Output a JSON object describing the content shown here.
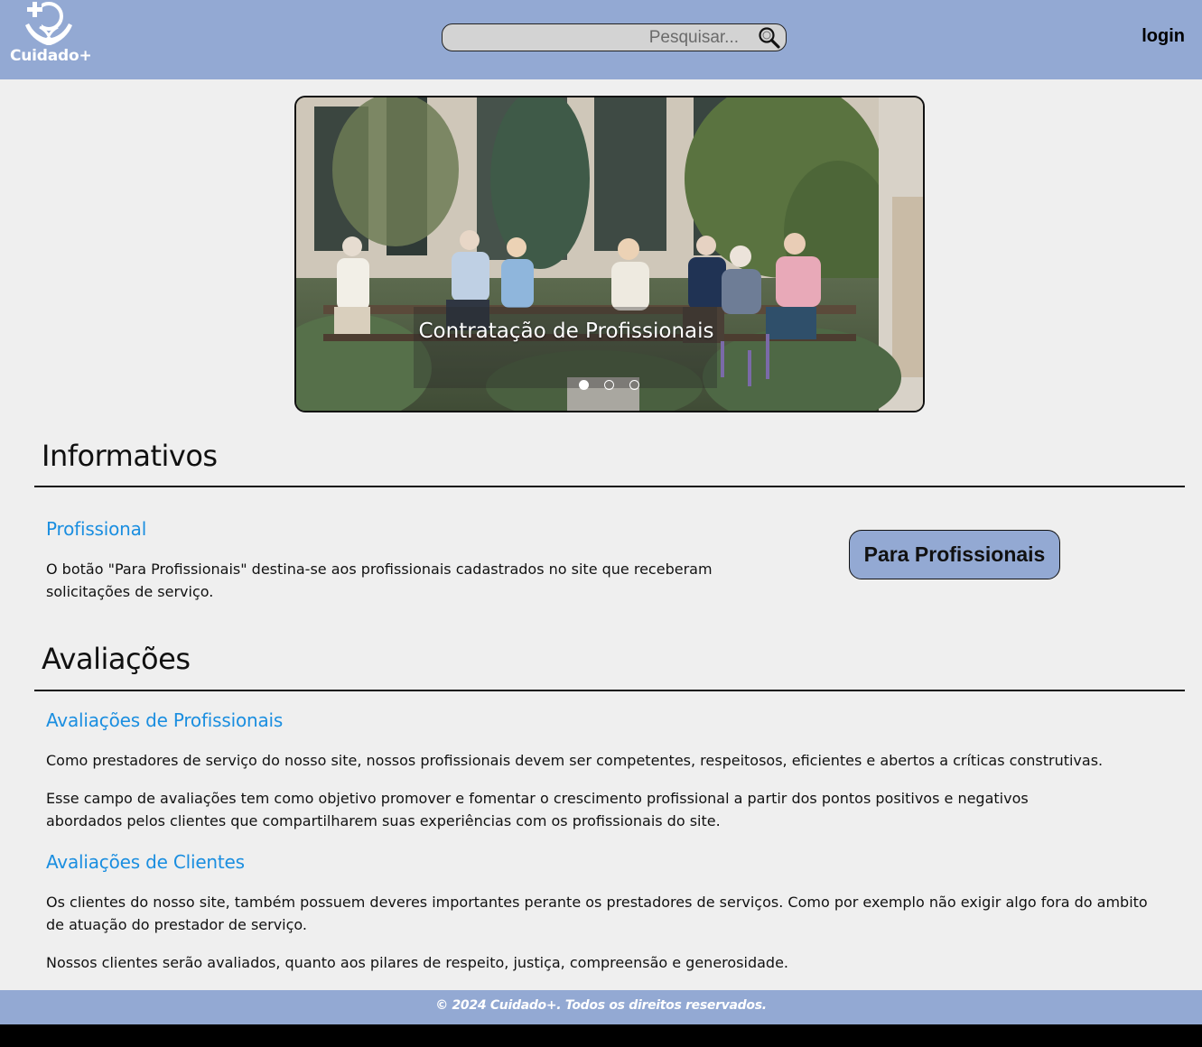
{
  "header": {
    "brand": "Cuidado+",
    "search_placeholder": "Pesquisar...",
    "login_label": "login"
  },
  "carousel": {
    "caption": "Contratação de Profissionais",
    "slides_count": 3,
    "active_slide": 1
  },
  "informativos": {
    "title": "Informativos",
    "subtitle": "Profissional",
    "text": "O botão \"Para Profissionais\" destina-se aos profissionais cadastrados no site que receberam solicitações de serviço.",
    "button_label": "Para Profissionais"
  },
  "avaliacoes": {
    "title": "Avaliações",
    "profissionais_title": "Avaliações de Profissionais",
    "profissionais_p1": "Como prestadores de serviço do nosso site, nossos profissionais devem ser competentes, respeitosos, eficientes e abertos a críticas construtivas.",
    "profissionais_p2": "Esse campo de avaliações tem como objetivo promover e fomentar o crescimento profissional a partir dos pontos positivos e negativos abordados pelos clientes que compartilharem suas experiências com os profissionais do site.",
    "clientes_title": "Avaliações de Clientes",
    "clientes_p1": "Os clientes do nosso site, também possuem deveres importantes perante os prestadores de serviços. Como por exemplo não exigir algo fora do ambito de atuação do prestador de serviço.",
    "clientes_p2": "Nossos clientes serão avaliados, quanto aos pilares de respeito, justiça, compreensão e generosidade."
  },
  "footer": {
    "text": "© 2024 Cuidado+. Todos os direitos reservados."
  },
  "colors": {
    "header_bg": "#93a9d3",
    "accent_blue": "#1a8ee0",
    "page_bg": "#efefef"
  }
}
